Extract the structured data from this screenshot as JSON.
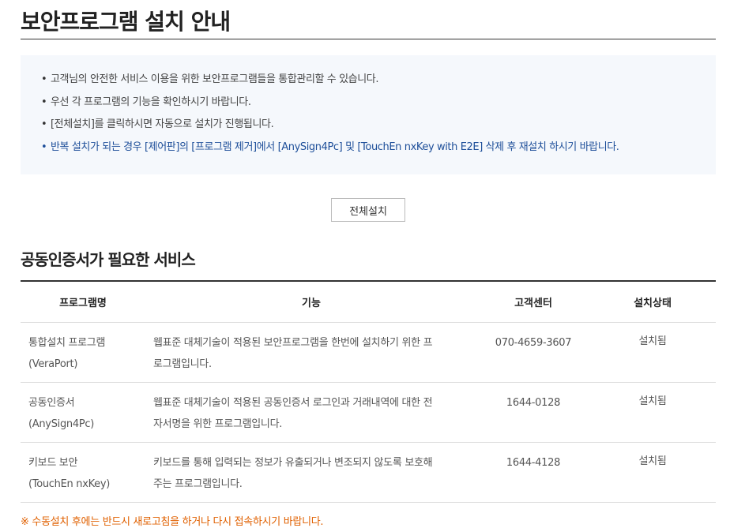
{
  "page": {
    "title": "보안프로그램 설치 안내"
  },
  "notice": {
    "items": [
      "고객님의 안전한 서비스 이용을 위한 보안프로그램들을 통합관리할 수 있습니다.",
      "우선 각 프로그램의 기능을 확인하시기 바랍니다.",
      "[전체설치]를 클릭하시면 자동으로 설치가 진행됩니다.",
      "반복 설치가 되는 경우 [제어판]의 [프로그램 제거]에서 [AnySign4Pc] 및 [TouchEn nxKey with E2E] 삭제 후 재설치 하시기 바랍니다."
    ]
  },
  "install_all_button": "전체설치",
  "section": {
    "title": "공동인증서가 필요한 서비스"
  },
  "table": {
    "headers": [
      "프로그램명",
      "기능",
      "고객센터",
      "설치상태"
    ],
    "rows": [
      {
        "name_line1": "통합설치 프로그램",
        "name_line2": "(VeraPort)",
        "function_line1": "웹표준 대체기술이 적용된 보안프로그램을 한번에 설치하기 위한 프",
        "function_line2": "로그램입니다.",
        "contact": "070-4659-3607",
        "status": "설치됨"
      },
      {
        "name_line1": "공동인증서",
        "name_line2": "(AnySign4Pc)",
        "function_line1": "웹표준 대체기술이 적용된 공동인증서 로그인과 거래내역에 대한 전",
        "function_line2": "자서명을 위한 프로그램입니다.",
        "contact": "1644-0128",
        "status": "설치됨"
      },
      {
        "name_line1": "키보드 보안",
        "name_line2": "(TouchEn nxKey)",
        "function_line1": "키보드를 통해 입력되는 정보가 유출되거나 변조되지 않도록 보호해",
        "function_line2": "주는 프로그램입니다.",
        "contact": "1644-4128",
        "status": "설치됨"
      }
    ]
  },
  "bottom_note": "※ 수동설치 후에는 반드시 새로고침을 하거나 다시 접속하시기 바랍니다."
}
